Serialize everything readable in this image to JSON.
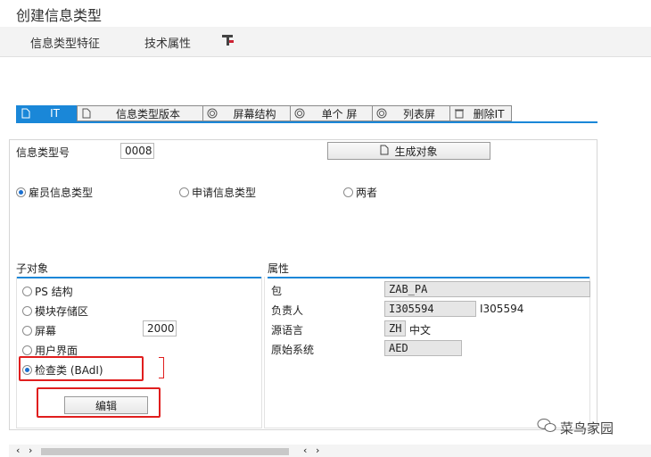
{
  "window": {
    "title": "创建信息类型"
  },
  "toolbar": {
    "btn1": "信息类型特征",
    "btn2": "技术属性"
  },
  "tabs": [
    "IT",
    "信息类型版本",
    "屏幕结构",
    "单个 屏",
    "列表屏",
    "删除IT"
  ],
  "header": {
    "infotype_label": "信息类型号",
    "infotype_value": "0008",
    "generate_label": "生成对象"
  },
  "radios_top": [
    "雇员信息类型",
    "申请信息类型",
    "两者"
  ],
  "subobjects": {
    "title": "子对象",
    "items": [
      "PS 结构",
      "模块存储区",
      "屏幕",
      "用户界面",
      "检查类 (BAdI)"
    ],
    "screen_value": "2000",
    "edit_label": "编辑"
  },
  "attributes": {
    "title": "属性",
    "rows": [
      {
        "label": "包",
        "value": "ZAB_PA",
        "extra": ""
      },
      {
        "label": "负责人",
        "value": "I305594",
        "extra": "I305594"
      },
      {
        "label": "源语言",
        "value": "ZH",
        "extra": "中文"
      },
      {
        "label": "原始系统",
        "value": "AED",
        "extra": ""
      }
    ]
  },
  "watermark": "菜鸟家园"
}
